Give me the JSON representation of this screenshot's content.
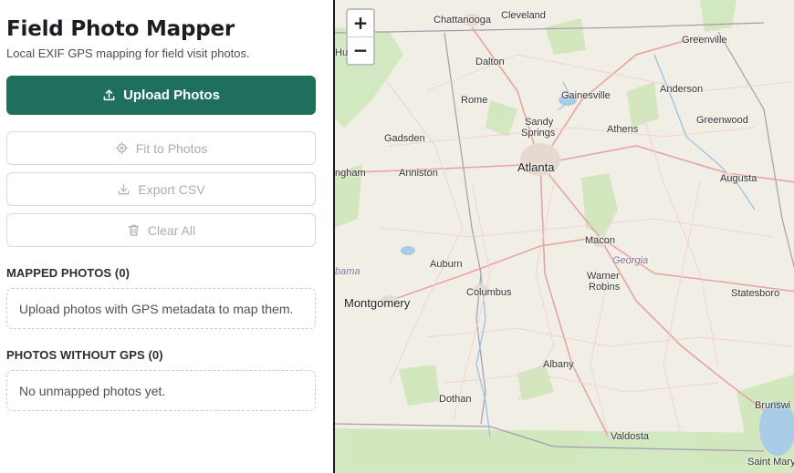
{
  "app": {
    "title": "Field Photo Mapper",
    "subtitle": "Local EXIF GPS mapping for field visit photos."
  },
  "actions": {
    "upload_label": "Upload Photos",
    "fit_label": "Fit to Photos",
    "export_label": "Export CSV",
    "clear_label": "Clear All"
  },
  "mapped": {
    "title": "MAPPED PHOTOS (0)",
    "empty_text": "Upload photos with GPS metadata to map them."
  },
  "unmapped": {
    "title": "PHOTOS WITHOUT GPS (0)",
    "empty_text": "No unmapped photos yet."
  },
  "map": {
    "zoom_in": "+",
    "zoom_out": "−",
    "cities": [
      {
        "name": "Chattanooga"
      },
      {
        "name": "Cleveland"
      },
      {
        "name": "Greenville"
      },
      {
        "name": "Hu"
      },
      {
        "name": "Dalton"
      },
      {
        "name": "Gainesville"
      },
      {
        "name": "Anderson"
      },
      {
        "name": "Rome"
      },
      {
        "name": "Sandy"
      },
      {
        "name": "Springs"
      },
      {
        "name": "Athens"
      },
      {
        "name": "Greenwood"
      },
      {
        "name": "Gadsden"
      },
      {
        "name": "Atlanta"
      },
      {
        "name": "ngham"
      },
      {
        "name": "Anniston"
      },
      {
        "name": "Augusta"
      },
      {
        "name": "Macon"
      },
      {
        "name": "Georgia"
      },
      {
        "name": "bama"
      },
      {
        "name": "Auburn"
      },
      {
        "name": "Warner"
      },
      {
        "name": "Robins"
      },
      {
        "name": "Montgomery"
      },
      {
        "name": "Columbus"
      },
      {
        "name": "Statesboro"
      },
      {
        "name": "Albany"
      },
      {
        "name": "Dothan"
      },
      {
        "name": "Brunswi"
      },
      {
        "name": "Valdosta"
      },
      {
        "name": "Saint Mary"
      }
    ]
  }
}
